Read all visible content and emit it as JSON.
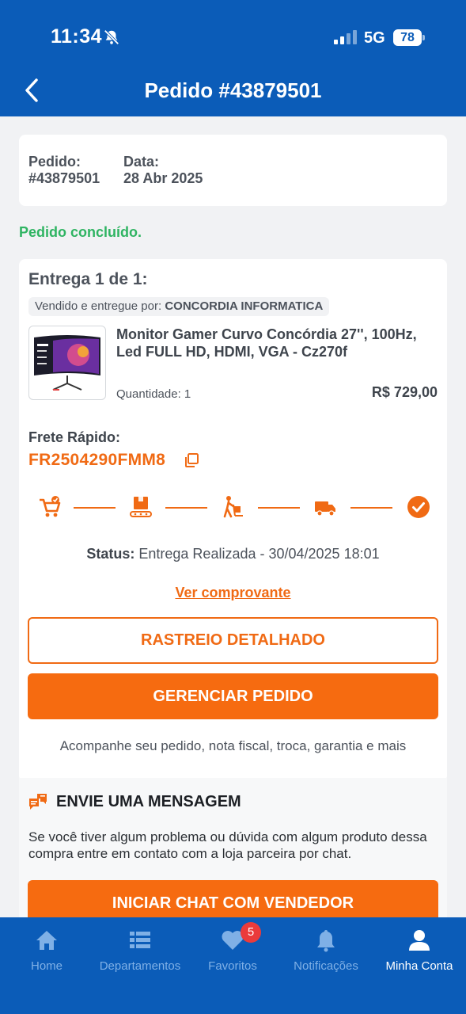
{
  "status_bar": {
    "time": "11:34",
    "network": "5G",
    "battery": "78"
  },
  "header": {
    "title": "Pedido #43879501"
  },
  "order": {
    "number_label": "Pedido:",
    "number_value": "#43879501",
    "date_label": "Data:",
    "date_value": "28 Abr 2025",
    "status_text": "Pedido concluído."
  },
  "delivery": {
    "heading": "Entrega 1 de 1:",
    "seller_prefix": "Vendido e entregue por:",
    "seller_name": "CONCORDIA INFORMATICA",
    "product_name": "Monitor Gamer Curvo Concórdia 27'', 100Hz, Led FULL HD, HDMI, VGA - Cz270f",
    "quantity": "Quantidade: 1",
    "price": "R$ 729,00",
    "shipping_label": "Frete Rápido:",
    "tracking_code": "FR2504290FMM8",
    "steps": [
      "cart-icon",
      "package-conveyor-icon",
      "hand-truck-icon",
      "truck-icon",
      "check-circle-icon"
    ],
    "status_label": "Status:",
    "status_value": "Entrega Realizada - 30/04/2025 18:01",
    "receipt_link": "Ver comprovante",
    "track_button": "RASTREIO DETALHADO",
    "manage_button": "GERENCIAR PEDIDO",
    "follow_text": "Acompanhe seu pedido, nota fiscal,  troca, garantia e mais"
  },
  "message": {
    "title": "ENVIE UMA MENSAGEM",
    "text": "Se você tiver algum problema ou dúvida com algum produto dessa compra entre em contato com a loja parceira por chat.",
    "chat_button": "INICIAR CHAT COM VENDEDOR"
  },
  "nav": {
    "items": [
      {
        "label": "Home",
        "icon": "home-icon"
      },
      {
        "label": "Departamentos",
        "icon": "list-icon"
      },
      {
        "label": "Favoritos",
        "icon": "heart-icon",
        "badge": "5"
      },
      {
        "label": "Notificações",
        "icon": "bell-icon"
      },
      {
        "label": "Minha Conta",
        "icon": "user-icon",
        "active": true
      }
    ]
  },
  "colors": {
    "brand_blue": "#0b5cb8",
    "accent_orange": "#f06a14",
    "success_green": "#2fb462",
    "badge_red": "#ea3b3b"
  }
}
